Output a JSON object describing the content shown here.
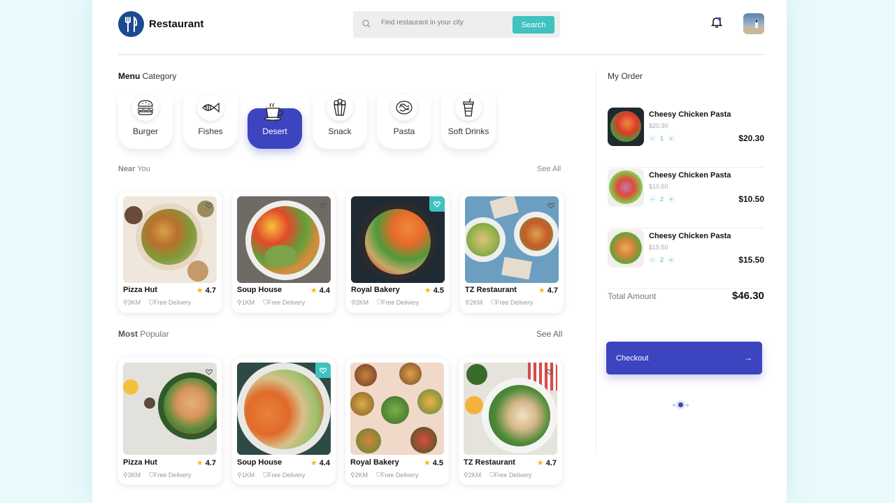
{
  "header": {
    "brand": "Restaurant",
    "search_placeholder": "Find restaurant in your city",
    "search_button": "Search"
  },
  "menu_category": {
    "title_bold": "Menu",
    "title_rest": " Category",
    "items": [
      {
        "label": "Burger",
        "icon": "burger-icon"
      },
      {
        "label": "Fishes",
        "icon": "fish-icon"
      },
      {
        "label": "Desert",
        "icon": "dessert-cup-icon",
        "active": true
      },
      {
        "label": "Snack",
        "icon": "popcorn-icon"
      },
      {
        "label": "Pasta",
        "icon": "pasta-icon"
      },
      {
        "label": "Soft Drinks",
        "icon": "soft-drink-icon"
      }
    ]
  },
  "near_you": {
    "title_bold": "Near",
    "title_rest": " You",
    "see_all": "See All",
    "cards": [
      {
        "name": "Pizza Hut",
        "rating": "4.7",
        "distance": "3KM",
        "delivery": "Free Delivery",
        "favorite": false
      },
      {
        "name": "Soup House",
        "rating": "4.4",
        "distance": "1KM",
        "delivery": "Free Delivery",
        "favorite": false
      },
      {
        "name": "Royal Bakery",
        "rating": "4.5",
        "distance": "2KM",
        "delivery": "Free Delivery",
        "favorite": true
      },
      {
        "name": "TZ Restaurant",
        "rating": "4.7",
        "distance": "2KM",
        "delivery": "Free Delivery",
        "favorite": false
      }
    ]
  },
  "most_popular": {
    "title_bold": "Most",
    "title_rest": " Popular",
    "see_all": "See All",
    "cards": [
      {
        "name": "Pizza Hut",
        "rating": "4.7",
        "distance": "3KM",
        "delivery": "Free Delivery",
        "favorite": false
      },
      {
        "name": "Soup House",
        "rating": "4.4",
        "distance": "1KM",
        "delivery": "Free Delivery",
        "favorite": true
      },
      {
        "name": "Royal Bakery",
        "rating": "4.5",
        "distance": "2KM",
        "delivery": "Free Delivery",
        "favorite": false
      },
      {
        "name": "TZ Restaurant",
        "rating": "4.7",
        "distance": "2KM",
        "delivery": "Free Delivery",
        "favorite": false
      }
    ]
  },
  "order": {
    "title": "My Order",
    "items": [
      {
        "name": "Cheesy Chicken Pasta",
        "unit_price": "$20.30",
        "qty": "1",
        "total": "$20.30"
      },
      {
        "name": "Cheesy Chicken Pasta",
        "unit_price": "$10.50",
        "qty": "2",
        "total": "$10.50"
      },
      {
        "name": "Cheesy Chicken Pasta",
        "unit_price": "$15.50",
        "qty": "2",
        "total": "$15.50"
      }
    ],
    "total_label": "Total Amount",
    "total_value": "$46.30",
    "checkout_label": "Checkout"
  },
  "colors": {
    "accent": "#3d44c0",
    "teal": "#3fc2c0",
    "star": "#f5b90f",
    "background": "#eaf9fb"
  }
}
